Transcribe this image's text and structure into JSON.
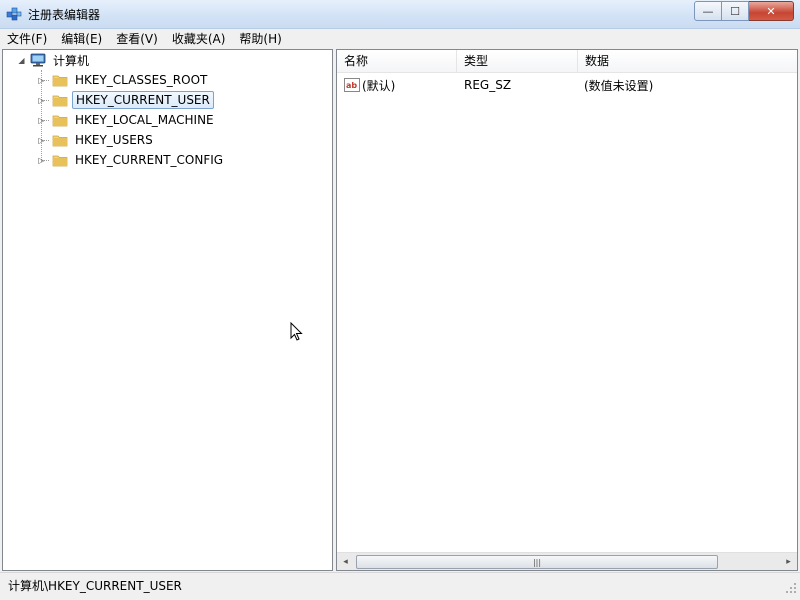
{
  "window": {
    "title": "注册表编辑器",
    "controls": {
      "minimize": "—",
      "maximize": "☐",
      "close": "✕"
    }
  },
  "menu": [
    "文件(F)",
    "编辑(E)",
    "查看(V)",
    "收藏夹(A)",
    "帮助(H)"
  ],
  "tree": {
    "root": {
      "label": "计算机",
      "icon": "computer-icon",
      "expander": "◢"
    },
    "items": [
      {
        "label": "HKEY_CLASSES_ROOT",
        "icon": "folder-icon",
        "expander": "▷"
      },
      {
        "label": "HKEY_CURRENT_USER",
        "icon": "folder-icon",
        "expander": "▷",
        "selected": true
      },
      {
        "label": "HKEY_LOCAL_MACHINE",
        "icon": "folder-icon",
        "expander": "▷"
      },
      {
        "label": "HKEY_USERS",
        "icon": "folder-icon",
        "expander": "▷"
      },
      {
        "label": "HKEY_CURRENT_CONFIG",
        "icon": "folder-icon",
        "expander": "▷"
      }
    ]
  },
  "list": {
    "columns": [
      "名称",
      "类型",
      "数据"
    ],
    "rows": [
      {
        "name": "(默认)",
        "type": "REG_SZ",
        "data": "(数值未设置)",
        "icon": "string-value-icon"
      }
    ]
  },
  "scrollbar": {
    "left_arrow": "◂",
    "right_arrow": "▸",
    "thumb_grip": "|||"
  },
  "status": {
    "path": "计算机\\HKEY_CURRENT_USER"
  },
  "colors": {
    "selection_border": "#7da2ce",
    "folder": "#e8c15a",
    "title_bg": "#d3e3f6"
  }
}
